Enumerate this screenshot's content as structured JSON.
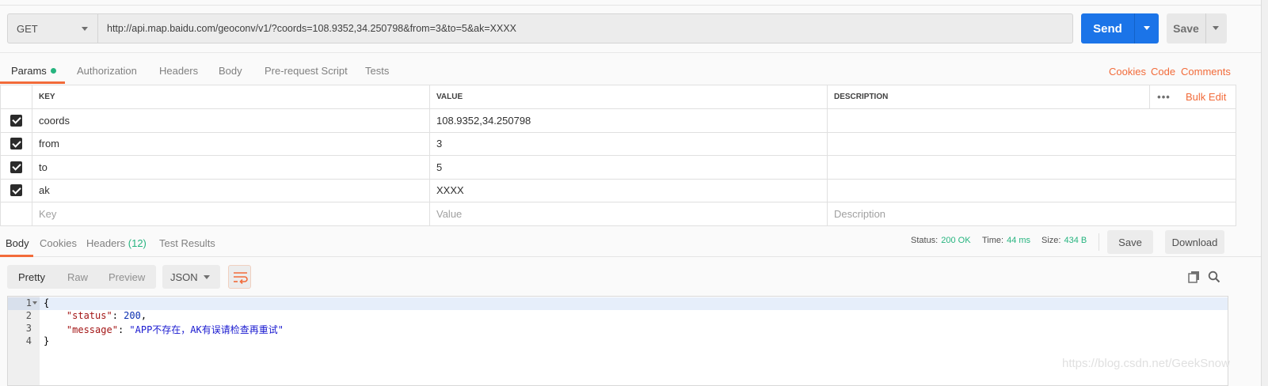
{
  "request": {
    "method": "GET",
    "url": "http://api.map.baidu.com/geoconv/v1/?coords=108.9352,34.250798&from=3&to=5&ak=XXXX",
    "send_label": "Send",
    "save_label": "Save"
  },
  "request_tabs": {
    "items": [
      "Params",
      "Authorization",
      "Headers",
      "Body",
      "Pre-request Script",
      "Tests"
    ],
    "right_links": [
      "Cookies",
      "Code",
      "Comments"
    ]
  },
  "params": {
    "headers": [
      "KEY",
      "VALUE",
      "DESCRIPTION"
    ],
    "more": "•••",
    "bulk_edit": "Bulk Edit",
    "rows": [
      {
        "key": "coords",
        "value": "108.9352,34.250798",
        "description": ""
      },
      {
        "key": "from",
        "value": "3",
        "description": ""
      },
      {
        "key": "to",
        "value": "5",
        "description": ""
      },
      {
        "key": "ak",
        "value": "XXXX",
        "description": ""
      }
    ],
    "placeholders": {
      "key": "Key",
      "value": "Value",
      "description": "Description"
    }
  },
  "response_tabs": {
    "body": "Body",
    "cookies": "Cookies",
    "headers": "Headers",
    "headers_count": "(12)",
    "test_results": "Test Results"
  },
  "response_status": {
    "status_label": "Status:",
    "status_value": "200 OK",
    "time_label": "Time:",
    "time_value": "44 ms",
    "size_label": "Size:",
    "size_value": "434 B",
    "save": "Save",
    "download": "Download"
  },
  "viewer": {
    "modes": [
      "Pretty",
      "Raw",
      "Preview"
    ],
    "format": "JSON"
  },
  "code": {
    "line_numbers": [
      "1",
      "2",
      "3",
      "4"
    ],
    "open_brace": "{",
    "close_brace": "}",
    "status_key": "\"status\"",
    "status_value": "200",
    "message_key": "\"message\"",
    "message_value": "\"APP不存在，AK有误请检查再重试\""
  },
  "watermark": "https://blog.csdn.net/GeekSnow",
  "colors": {
    "accent": "#f26b3a",
    "send": "#1b74e8",
    "success": "#26b47f"
  }
}
